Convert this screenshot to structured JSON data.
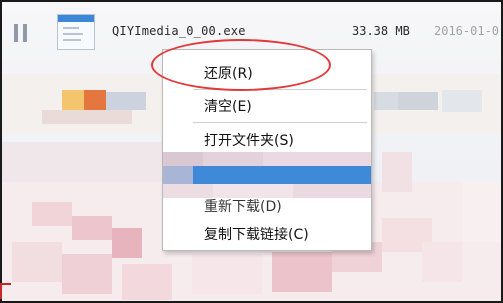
{
  "download_item": {
    "file_name": "QIYImedia_0_00.exe",
    "file_size": "33.38 MB",
    "date": "2016-01-0"
  },
  "context_menu": {
    "items": [
      {
        "label": "还原(R)"
      },
      {
        "label": "清空(E)"
      },
      {
        "label": "打开文件夹(S)"
      },
      {
        "label": ""
      },
      {
        "label": "重新下载(D)"
      },
      {
        "label": "复制下载链接(C)"
      }
    ]
  },
  "colors": {
    "highlight": "#3f8ad8",
    "annotation": "#e23a3a",
    "file_icon_bar": "#3d87d8"
  },
  "icons": [
    "pause-icon",
    "file-icon"
  ]
}
